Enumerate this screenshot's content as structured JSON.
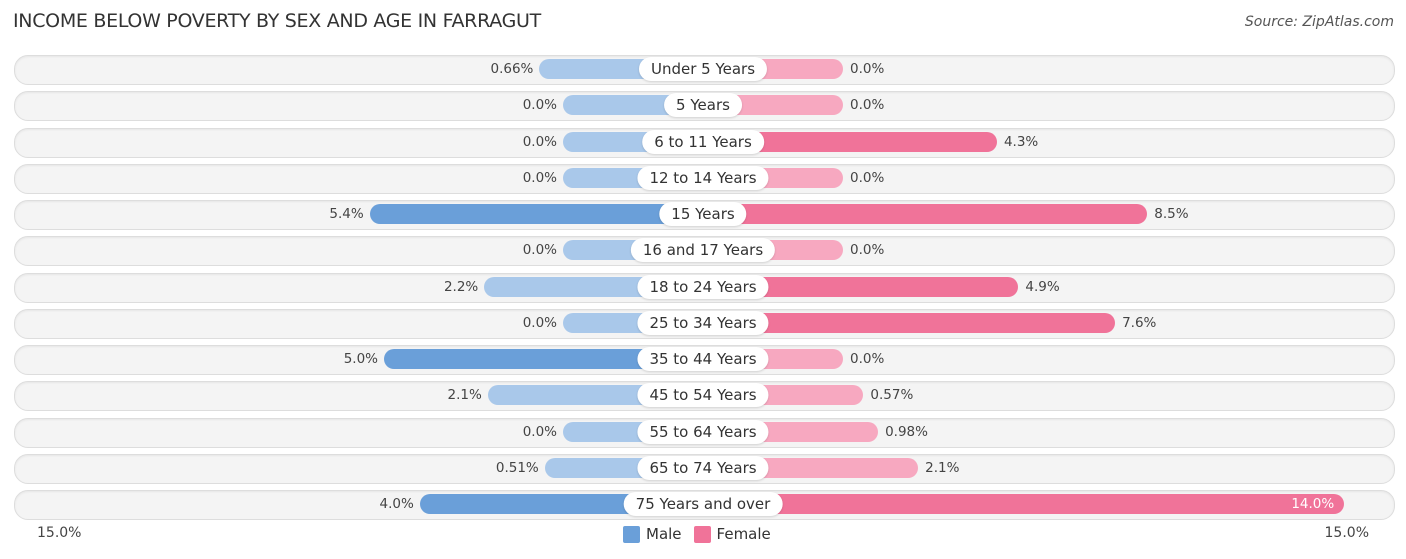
{
  "header": {
    "title": "INCOME BELOW POVERTY BY SEX AND AGE IN FARRAGUT",
    "source": "Source: ZipAtlas.com"
  },
  "colors": {
    "male_light": "#a9c8ea",
    "male_strong": "#6a9fd9",
    "female_light": "#f7a8c0",
    "female_strong": "#f07399"
  },
  "chart_data": {
    "type": "bar",
    "orientation": "diverging-horizontal",
    "title": "INCOME BELOW POVERTY BY SEX AND AGE IN FARRAGUT",
    "categories": [
      "Under 5 Years",
      "5 Years",
      "6 to 11 Years",
      "12 to 14 Years",
      "15 Years",
      "16 and 17 Years",
      "18 to 24 Years",
      "25 to 34 Years",
      "35 to 44 Years",
      "45 to 54 Years",
      "55 to 64 Years",
      "65 to 74 Years",
      "75 Years and over"
    ],
    "series": [
      {
        "name": "Male",
        "values": [
          0.66,
          0.0,
          0.0,
          0.0,
          5.4,
          0.0,
          2.2,
          0.0,
          5.0,
          2.1,
          0.0,
          0.51,
          4.0
        ],
        "labels": [
          "0.66%",
          "0.0%",
          "0.0%",
          "0.0%",
          "5.4%",
          "0.0%",
          "2.2%",
          "0.0%",
          "5.0%",
          "2.1%",
          "0.0%",
          "0.51%",
          "4.0%"
        ]
      },
      {
        "name": "Female",
        "values": [
          0.0,
          0.0,
          4.3,
          0.0,
          8.5,
          0.0,
          4.9,
          7.6,
          0.0,
          0.57,
          0.98,
          2.1,
          14.0
        ],
        "labels": [
          "0.0%",
          "0.0%",
          "4.3%",
          "0.0%",
          "8.5%",
          "0.0%",
          "4.9%",
          "7.6%",
          "0.0%",
          "0.57%",
          "0.98%",
          "2.1%",
          "14.0%"
        ]
      }
    ],
    "axis": {
      "left_label": "15.0%",
      "right_label": "15.0%",
      "max": 15.0
    },
    "legend": {
      "position": "bottom-center",
      "entries": [
        "Male",
        "Female"
      ]
    }
  }
}
